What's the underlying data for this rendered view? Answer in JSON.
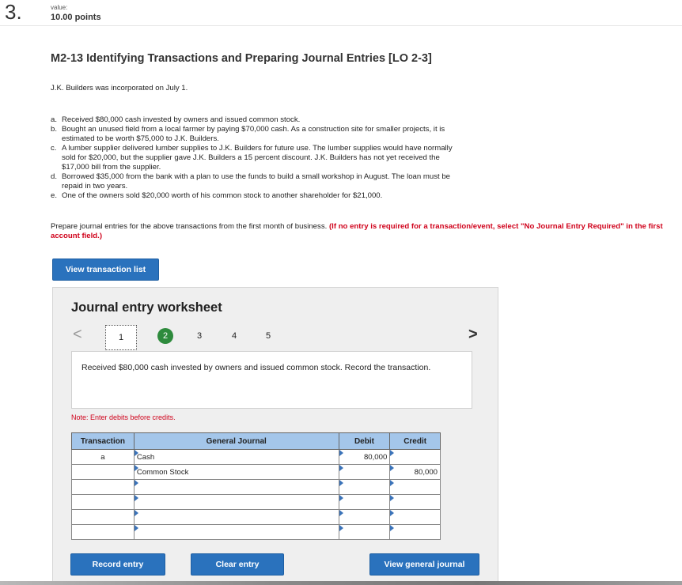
{
  "header": {
    "question_number": "3.",
    "value_label": "value:",
    "points": "10.00 points"
  },
  "problem": {
    "title": "M2-13 Identifying Transactions and Preparing Journal Entries [LO 2-3]",
    "intro": "J.K. Builders was incorporated on July 1.",
    "transactions": [
      {
        "letter": "a.",
        "text": "Received $80,000 cash invested by owners and issued common stock."
      },
      {
        "letter": "b.",
        "text": "Bought an unused field from a local farmer by paying $70,000 cash. As a construction site for smaller projects, it is estimated to be worth $75,000 to J.K. Builders."
      },
      {
        "letter": "c.",
        "text": "A lumber supplier delivered lumber supplies to J.K. Builders for future use. The lumber supplies would have normally sold for $20,000, but the supplier gave J.K. Builders a 15 percent discount. J.K. Builders has not yet received the $17,000 bill from the supplier."
      },
      {
        "letter": "d.",
        "text": "Borrowed $35,000 from the bank with a plan to use the funds to build a small workshop in August. The loan must be repaid in two years."
      },
      {
        "letter": "e.",
        "text": "One of the owners sold $20,000 worth of his common stock to another shareholder for $21,000."
      }
    ],
    "prompt": "Prepare journal entries for the above transactions from the first month of business.",
    "prompt_emphasis": "(If no entry is required for a transaction/event, select \"No Journal Entry Required\" in the first account field.)"
  },
  "buttons": {
    "view_transaction_list": "View transaction list",
    "record_entry": "Record entry",
    "clear_entry": "Clear entry",
    "view_general_journal": "View general journal"
  },
  "worksheet": {
    "title": "Journal entry worksheet",
    "steps": [
      "1",
      "2",
      "3",
      "4",
      "5"
    ],
    "prev_glyph": "<",
    "next_glyph": ">",
    "description": "Received $80,000 cash invested by owners and issued common stock. Record the transaction.",
    "note": "Note: Enter debits before credits.",
    "table": {
      "headers": [
        "Transaction",
        "General Journal",
        "Debit",
        "Credit"
      ],
      "rows": [
        {
          "transaction": "a",
          "account": "Cash",
          "debit": "80,000",
          "credit": ""
        },
        {
          "transaction": "",
          "account": "Common Stock",
          "debit": "",
          "credit": "80,000"
        },
        {
          "transaction": "",
          "account": "",
          "debit": "",
          "credit": ""
        },
        {
          "transaction": "",
          "account": "",
          "debit": "",
          "credit": ""
        },
        {
          "transaction": "",
          "account": "",
          "debit": "",
          "credit": ""
        },
        {
          "transaction": "",
          "account": "",
          "debit": "",
          "credit": ""
        }
      ]
    }
  },
  "colors": {
    "button_blue": "#2a72bd",
    "header_blue": "#a4c6ea",
    "error_red": "#d0021b",
    "active_step_green": "#2e8b3d"
  }
}
